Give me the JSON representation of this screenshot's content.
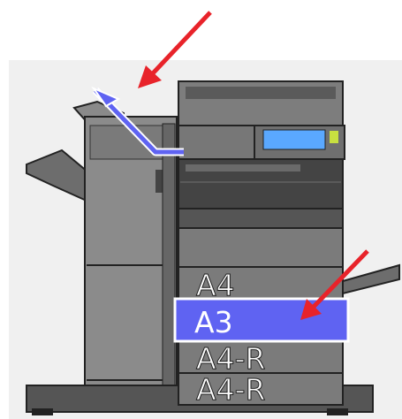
{
  "printer": {
    "trays": [
      {
        "label": "A4",
        "selected": false
      },
      {
        "label": "A3",
        "selected": true
      },
      {
        "label": "A4-R",
        "selected": false
      },
      {
        "label": "A4-R",
        "selected": false
      }
    ],
    "output_tray_highlighted": true
  },
  "colors": {
    "highlight": "#5f63f2",
    "arrow": "#e8232a",
    "panel_screen": "#5aa8ff",
    "body": "#7a7a7a"
  },
  "annotations": [
    {
      "name": "output-tray-arrow",
      "points_to": "output-tray"
    },
    {
      "name": "selected-tray-arrow",
      "points_to": "tray-A3"
    }
  ]
}
